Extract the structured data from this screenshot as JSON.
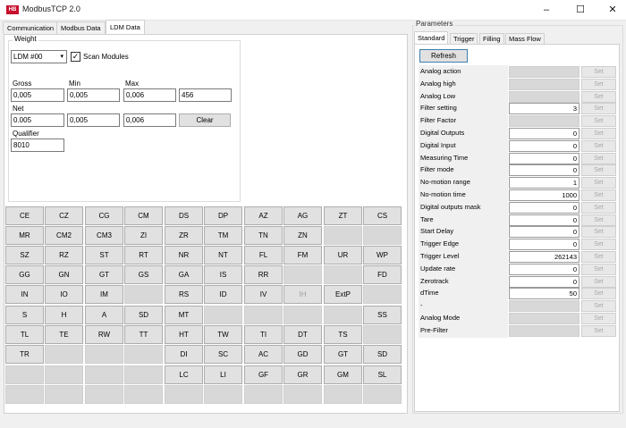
{
  "window": {
    "logo": "HB",
    "title": "ModbusTCP 2.0",
    "minimize_glyph": "–",
    "maximize_glyph": "☐",
    "close_glyph": "✕"
  },
  "tabs": [
    "Communication",
    "Modbus Data",
    "LDM Data"
  ],
  "active_tab": "LDM Data",
  "weight": {
    "group_title": "Weight",
    "device": "LDM #00",
    "scan_modules_label": "Scan Modules",
    "scan_modules_checked": true,
    "check_glyph": "✓",
    "gross_label": "Gross",
    "min_label": "Min",
    "max_label": "Max",
    "gross": "0,005",
    "gross_min": "0,005",
    "gross_max": "0,006",
    "gross_extra": "456",
    "net_label": "Net",
    "net": "0.005",
    "net_min": "0,005",
    "net_max": "0,006",
    "clear_label": "Clear",
    "qualifier_label": "Qualifier",
    "qualifier": "8010"
  },
  "command_grid": [
    [
      "CE",
      "CZ",
      "CG",
      "CM",
      "DS",
      "DP",
      "AZ",
      "AG",
      "ZT",
      "CS"
    ],
    [
      "MR",
      "CM2",
      "CM3",
      "ZI",
      "ZR",
      "TM",
      "TN",
      "ZN",
      "",
      ""
    ],
    [
      "SZ",
      "RZ",
      "ST",
      "RT",
      "NR",
      "NT",
      "FL",
      "FM",
      "UR",
      "WP"
    ],
    [
      "GG",
      "GN",
      "GT",
      "GS",
      "GA",
      "IS",
      "RR",
      "",
      "",
      "FD"
    ],
    [
      "IN",
      "IO",
      "IM",
      "",
      "RS",
      "ID",
      "IV",
      "IH",
      "ExtP",
      ""
    ],
    [
      "S",
      "H",
      "A",
      "SD",
      "MT",
      "",
      "",
      "",
      "",
      "SS"
    ],
    [
      "TL",
      "TE",
      "RW",
      "TT",
      "HT",
      "TW",
      "TI",
      "DT",
      "TS",
      ""
    ],
    [
      "TR",
      "",
      "",
      "",
      "DI",
      "SC",
      "AC",
      "GD",
      "GT",
      "SD"
    ],
    [
      "",
      "",
      "",
      "",
      "LC",
      "LI",
      "GF",
      "GR",
      "GM",
      "SL"
    ],
    [
      "",
      "",
      "",
      "",
      "",
      "",
      "",
      "",
      "",
      ""
    ]
  ],
  "disabled_commands": [
    "IH"
  ],
  "parameters": {
    "title": "Parameters",
    "tabs": [
      "Standard",
      "Trigger",
      "Filling",
      "Mass Flow"
    ],
    "active_tab": "Standard",
    "refresh_label": "Refresh",
    "set_label": "Set",
    "rows": [
      {
        "label": "Analog action",
        "value": "",
        "readonly": true
      },
      {
        "label": "Analog high",
        "value": "",
        "readonly": true
      },
      {
        "label": "Analog Low",
        "value": "",
        "readonly": true
      },
      {
        "label": "Filter setting",
        "value": "3",
        "readonly": false
      },
      {
        "label": "Filter Factor",
        "value": "",
        "readonly": true
      },
      {
        "label": "Digital Outputs",
        "value": "0",
        "readonly": false
      },
      {
        "label": "Digital Input",
        "value": "0",
        "readonly": false
      },
      {
        "label": "Measuring Time",
        "value": "0",
        "readonly": false
      },
      {
        "label": "Filter mode",
        "value": "0",
        "readonly": false
      },
      {
        "label": "No-motion range",
        "value": "1",
        "readonly": false
      },
      {
        "label": "No-motion time",
        "value": "1000",
        "readonly": false
      },
      {
        "label": "Digital outputs mask",
        "value": "0",
        "readonly": false
      },
      {
        "label": "Tare",
        "value": "0",
        "readonly": false
      },
      {
        "label": "Start Delay",
        "value": "0",
        "readonly": false
      },
      {
        "label": "Trigger Edge",
        "value": "0",
        "readonly": false
      },
      {
        "label": "Trigger Level",
        "value": "262143",
        "readonly": false
      },
      {
        "label": "Update rate",
        "value": "0",
        "readonly": false
      },
      {
        "label": "Zerotrack",
        "value": "0",
        "readonly": false
      },
      {
        "label": "dTime",
        "value": "50",
        "readonly": false
      },
      {
        "label": "-",
        "value": "",
        "readonly": true
      },
      {
        "label": "Analog Mode",
        "value": "",
        "readonly": true
      },
      {
        "label": "Pre-Filter",
        "value": "",
        "readonly": true
      }
    ]
  }
}
